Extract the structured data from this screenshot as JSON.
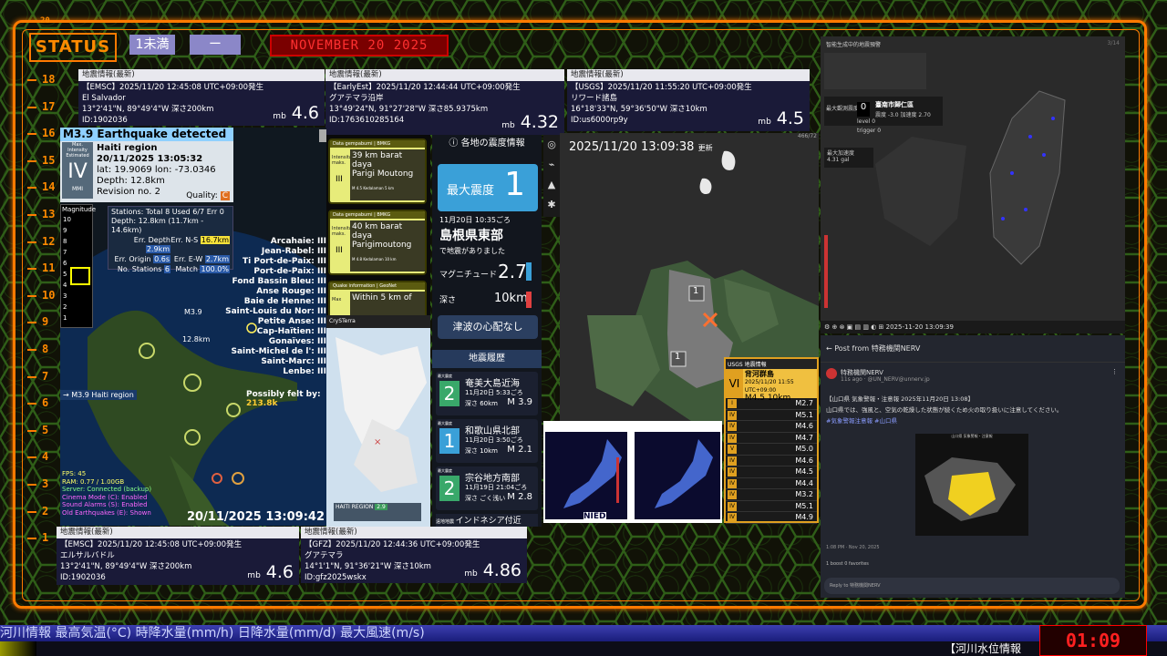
{
  "top": {
    "row_top": "20",
    "status_label": "STATUS",
    "badge1": "1未満",
    "badge2": "ー",
    "date": "NOVEMBER 20  2025"
  },
  "rownums": [
    "18",
    "17",
    "16",
    "15",
    "14",
    "13",
    "12",
    "11",
    "10",
    "9",
    "8",
    "7",
    "6",
    "5",
    "4",
    "3",
    "2",
    "1"
  ],
  "quakes": [
    {
      "header": "地震情報(最新)",
      "src": "【EMSC】2025/11/20  12:45:08  UTC+09:00発生",
      "place": "El Salvador",
      "coord": "13°2'41\"N,  89°49'4\"W  深さ200km",
      "id": "ID:1902036",
      "mb_label": "mb",
      "mb": "4.6"
    },
    {
      "header": "地震情報(最新)",
      "src": "【EarlyEst】2025/11/20  12:44:44  UTC+09:00発生",
      "place": "グアテマラ沿岸",
      "coord": "13°49'24\"N,  91°27'28\"W  深さ85.9375km",
      "id": "ID:1763610285164",
      "mb_label": "mb",
      "mb": "4.32"
    },
    {
      "header": "地震情報(最新)",
      "src": "【USGS】2025/11/20  11:55:20  UTC+09:00発生",
      "place": "リワード諸島",
      "coord": "16°18'33\"N,  59°36'50\"W  深さ10km",
      "id": "ID:us6000rp9y",
      "mb_label": "mb",
      "mb": "4.5"
    },
    {
      "header": "地震情報(最新)",
      "src": "【EMSC】2025/11/20  12:45:08  UTC+09:00発生",
      "place": "エルサルバドル",
      "coord": "13°2'41\"N,  89°49'4\"W  深さ200km",
      "id": "ID:1902036",
      "mb_label": "mb",
      "mb": "4.6"
    },
    {
      "header": "地震情報(最新)",
      "src": "【GFZ】2025/11/20  12:44:36  UTC+09:00発生",
      "place": "グアテマラ",
      "coord": "14°1'1\"N,  91°36'21\"W  深さ10km",
      "id": "ID:gfz2025wskx",
      "mb_label": "mb",
      "mb": "4.86"
    }
  ],
  "haiti": {
    "title": "M3.9 Earthquake detected",
    "intensity_label": "Max. Intensity Estimated",
    "intensity": "IV",
    "mmi": "MMI",
    "region": "Haiti region",
    "time": "20/11/2025 13:05:32",
    "latlon": "lat: 19.9069 lon: -73.0346",
    "depth": "Depth: 12.8km",
    "revision": "Revision no. 2",
    "quality": "Quality:",
    "quality_val": "C",
    "magnitude_label": "Magnitude",
    "stations": "Stations: Total 8 Used 6/7 Err 0",
    "depth2": "Depth: 12.8km (11.7km - 14.6km)",
    "errs": [
      {
        "k": "Err. Depth",
        "v": "2.9km"
      },
      {
        "k": "Err. N-S",
        "v": "16.7km"
      },
      {
        "k": "Err. Origin",
        "v": "0.6s"
      },
      {
        "k": "Err. E-W",
        "v": "2.7km"
      },
      {
        "k": "No. Stations",
        "v": "6"
      },
      {
        "k": "Match",
        "v": "100.0%"
      }
    ],
    "towns": [
      "Arcahaie:",
      "Jean-Rabel:",
      "Ti Port-de-Paix:",
      "Port-de-Paix:",
      "Fond Bassin Bleu:",
      "Anse Rouge:",
      "Baie de Henne:",
      "Saint-Louis du Nor:",
      "Petite Anse:",
      "Cap-Haïtien:",
      "Gonaïves:",
      "Saint-Michel de l':",
      "Saint-Marc:",
      "Lenbe:"
    ],
    "felt": "Possibly felt by:",
    "felt_val": "213.8k",
    "map_mag": "M3.9",
    "map_depth": "12.8km",
    "side_link": "→ M3.9 Haiti region",
    "status_lines": [
      "FPS: 45",
      "RAM: 0.77 / 1.00GB",
      "Server: Connected (backup)",
      "Cinema Mode (C): Enabled",
      "Sound Alarms (S): Enabled",
      "Old Earthquakes (E): Shown"
    ],
    "clock": "20/11/2025 13:09:42",
    "mag_scale": [
      "10",
      "9",
      "8",
      "7",
      "6",
      "5",
      "4",
      "3",
      "2",
      "1"
    ]
  },
  "indo": [
    {
      "hd": "Data gempabumi | BMKG",
      "dist": "39 km barat daya",
      "place": "Parigi Moutong",
      "lbl": "Intensitas maks.",
      "lvl": "III",
      "foot": "M 4.5    Kedalaman 5 km"
    },
    {
      "hd": "Data gempabumi | BMKG",
      "dist": "40 km barat daya",
      "place": "Parigimoutong",
      "lbl": "Intensitas maks.",
      "lvl": "III",
      "foot": "M 4.8    Kedalaman 10 km"
    },
    {
      "hd": "Quake information | GeoNet",
      "dist": "Within 5 km of",
      "place": "",
      "lbl": "Max",
      "lvl": "",
      "foot": ""
    }
  ],
  "phone": {
    "app": "CrySTerra",
    "region": "HAITI REGION",
    "mag": "2.9"
  },
  "jma": {
    "title": "各地の震度情報",
    "max_label": "最大震度",
    "max": "1",
    "time": "11月20日 10:35ごろ",
    "place": "島根県東部",
    "note": "で地震がありました",
    "mag_label": "マグニチュード",
    "mag": "2.7",
    "depth_label": "深さ",
    "depth": "10km",
    "tsunami": "津波の心配なし",
    "hist_title": "地震履歴",
    "hist": [
      {
        "i": "2",
        "place": "奄美大島近海",
        "time": "11月20日 5:33ごろ",
        "depth": "深さ  60km",
        "m": "M 3.9",
        "lbl": "最大震度"
      },
      {
        "i": "1",
        "place": "和歌山県北部",
        "time": "11月20日 3:50ごろ",
        "depth": "深さ  10km",
        "m": "M 2.1",
        "lbl": "最大震度"
      },
      {
        "i": "2",
        "place": "宗谷地方南部",
        "time": "11月19日 21:04ごろ",
        "depth": "深さ ごく浅い",
        "m": "M 2.8",
        "lbl": "最大震度"
      }
    ],
    "hist_more": "インドネシア付近",
    "hist_more_lbl": "遠地地震"
  },
  "map": {
    "time": "2025/11/20  13:09:38",
    "updated": "更新",
    "corner": "466/72",
    "box1": "1",
    "box2": "1"
  },
  "usgs": {
    "title": "USGS 地震情報",
    "int": "VI",
    "place": "背河群島",
    "sub": "2025/11/20 11:55 UTC+09:00",
    "mag": "M4.5",
    "depth": "10km",
    "list": [
      {
        "i": "I",
        "m": "M2.7"
      },
      {
        "i": "IV",
        "m": "M5.1"
      },
      {
        "i": "IV",
        "m": "M4.6"
      },
      {
        "i": "IV",
        "m": "M4.7"
      },
      {
        "i": "V",
        "m": "M5.0"
      },
      {
        "i": "IV",
        "m": "M4.6"
      },
      {
        "i": "IV",
        "m": "M4.5"
      },
      {
        "i": "IV",
        "m": "M4.4"
      },
      {
        "i": "IV",
        "m": "M3.2"
      },
      {
        "i": "IV",
        "m": "M5.1"
      },
      {
        "i": "IV",
        "m": "M4.9"
      }
    ]
  },
  "nied": {
    "label": "NIED"
  },
  "taiwan": {
    "title": "智能生成中的地震預警",
    "max_label": "最大觀測震度",
    "max": "0",
    "place": "臺南市歸仁區",
    "place_sub": "震度 -3.0  加速度 2.70",
    "level": "level",
    "trigger": "trigger",
    "lv": "0",
    "tr": "0",
    "max2_label": "最大加速度",
    "pga": "4.31 gal",
    "corner": "3/14",
    "footer_time": "2025-11-20 13:09:39"
  },
  "post": {
    "header": "Post from 特務機関NERV",
    "account": "特務機関NERV",
    "handle": "11s ago · @UN_NERV@unnerv.jp",
    "text1": "【山口県 気象警報・注意報 2025年11月20日 13:08】",
    "text2": "山口県では、強風と、空気の乾燥した状態が続くため火の取り扱いに注意してください。",
    "tags": "#気象警報注意報 #山口県",
    "map_title": "山口県 気象警報・注意報",
    "time": "1:08 PM · Nov 20, 2025",
    "stats": "1 boost   0 favorites",
    "reply": "Reply to 特務機関NERV"
  },
  "ticker": {
    "top": "河川情報        最高気温(°C)      時降水量(mm/h)     日降水量(mm/d)    最大風速(m/s)",
    "bottom": "【河川水位情報",
    "clock": "01:09"
  },
  "colors": {
    "accent": "#ff7a00",
    "hex": "#2e5a16"
  }
}
